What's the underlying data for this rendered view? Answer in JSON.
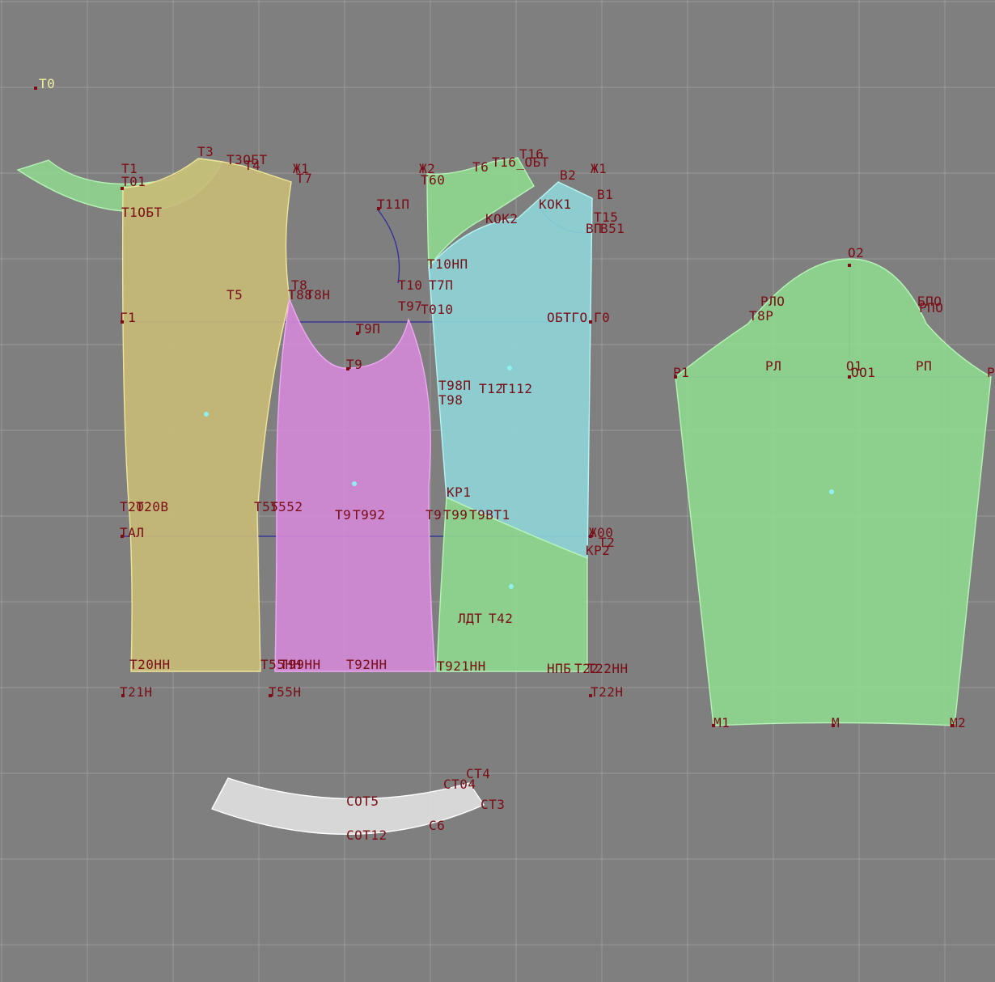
{
  "colors": {
    "background": "#7f7f7f",
    "grid": "#9a9a9a",
    "label": "#7a0d16",
    "origin_label": "#f1f1a0",
    "construction_line": "#2a2a9a",
    "piece_yellow": "#c9bb78",
    "piece_green": "#8fd98f",
    "piece_pink": "#d48ad8",
    "piece_cyan": "#8fd6d8",
    "piece_white": "#dcdcdc"
  },
  "origin_label": "T0",
  "pieces": [
    {
      "name": "facing-piece",
      "color": "piece_green"
    },
    {
      "name": "back-panel",
      "color": "piece_yellow"
    },
    {
      "name": "side-panel",
      "color": "piece_pink"
    },
    {
      "name": "front-upper-panel",
      "color": "piece_green"
    },
    {
      "name": "front-middle-panel",
      "color": "piece_cyan"
    },
    {
      "name": "front-lower-panel",
      "color": "piece_green"
    },
    {
      "name": "sleeve-piece",
      "color": "piece_green"
    },
    {
      "name": "collar-piece",
      "color": "piece_white"
    }
  ],
  "labels": {
    "t3": "T3",
    "t3obt": "T3ОБТ",
    "t4": "T4",
    "zh1": "Ж1",
    "t7": "T7",
    "t1": "T1",
    "t01": "T01",
    "t1obt": "T1ОБТ",
    "t5": "T5",
    "t8": "T8",
    "t88": "T88",
    "t8n": "T8Н",
    "g1": "Г1",
    "t11p": "T11П",
    "t10np": "T10НП",
    "t10": "T10",
    "t7p": "T7П",
    "t97": "T97",
    "t010": "T010",
    "t9p": "T9П",
    "t9": "T9",
    "t98p": "T98П",
    "t98": "T98",
    "t12": "T12",
    "t112": "T112",
    "zh2": "Ж2",
    "t60": "T60",
    "t6": "T6",
    "t16": "T16",
    "t16obt": "T16_ОБТ",
    "b2": "В2",
    "zh1b": "Ж1",
    "b1": "В1",
    "kok1": "КОК1",
    "kok2": "КОК2",
    "t15": "T15",
    "vp": "ВП",
    "b51": "В51",
    "obtgo": "ОБТГО",
    "g0": "Г0",
    "t20": "T20",
    "t20b": "T20В",
    "t55": "T55",
    "t552": "T552",
    "t9a": "T9",
    "t992": "T992",
    "t9b": "T9",
    "t99": "T99",
    "t9bt1": "T9ВТ1",
    "kp1": "КР1",
    "tal": "TАЛ",
    "zh00": "Ж00",
    "t2": "T2",
    "kp2": "КР2",
    "ldt": "ЛДТ",
    "t42": "T42",
    "t20nn": "T20НН",
    "t55nn": "T55НН",
    "t99nn": "T99НН",
    "t92hh": "T92НН",
    "t921hh": "T921НН",
    "npb": "НПБ",
    "t22hh": "T22НН",
    "t22": "T22",
    "t21h": "T21Н",
    "t55h": "T55Н",
    "t22h": "T22Н",
    "o2": "О2",
    "rlo": "РЛО",
    "bpo": "БПО",
    "rpo": "РПО",
    "t8r": "T8Р",
    "r1": "Р1",
    "rl": "РЛ",
    "o1": "О1",
    "oo1": "ОО1",
    "rp": "РП",
    "r": "Р",
    "m1": "М1",
    "m": "М",
    "m2": "М2",
    "st4": "СТ4",
    "st04": "СТ04",
    "sot5": "СОТ5",
    "st3": "СТ3",
    "sot12": "СОТ12",
    "s6": "С6"
  }
}
